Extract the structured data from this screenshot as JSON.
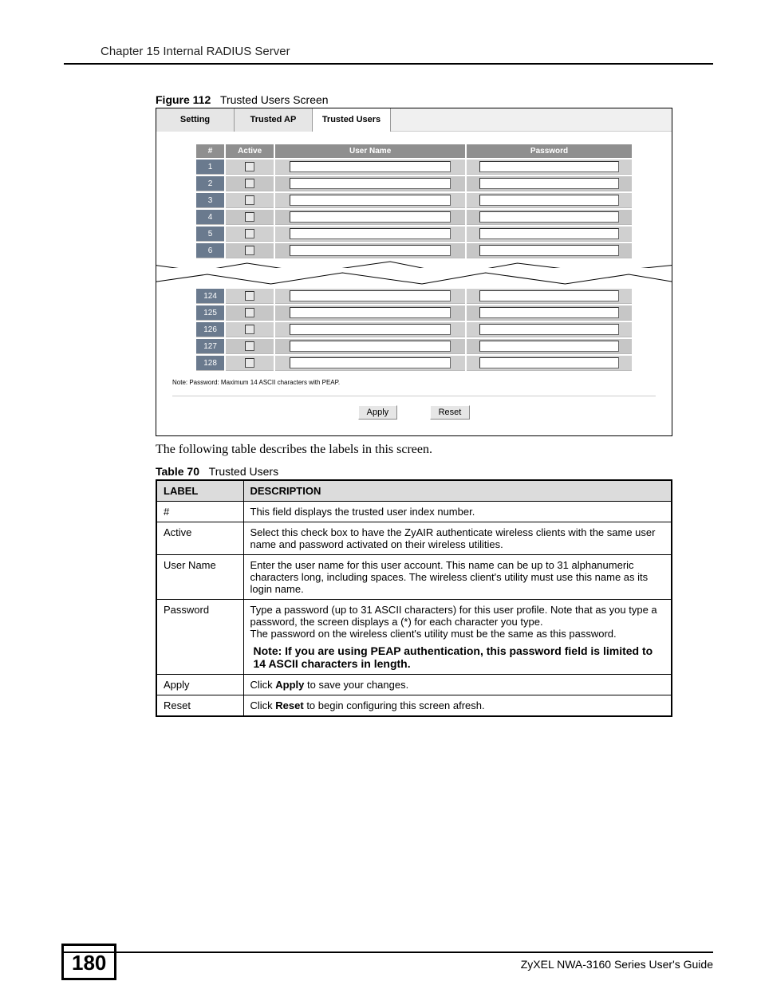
{
  "chapter": "Chapter 15 Internal RADIUS Server",
  "figure": {
    "label": "Figure 112",
    "title": "Trusted Users Screen"
  },
  "tabs": {
    "setting": "Setting",
    "trusted_ap": "Trusted AP",
    "trusted_users": "Trusted Users"
  },
  "cols": {
    "num": "#",
    "active": "Active",
    "user_name": "User Name",
    "password": "Password"
  },
  "rows_top": [
    "1",
    "2",
    "3",
    "4",
    "5",
    "6"
  ],
  "rows_bottom": [
    "124",
    "125",
    "126",
    "127",
    "128"
  ],
  "note": "Note: Password: Maximum 14 ASCII characters with PEAP.",
  "buttons": {
    "apply": "Apply",
    "reset": "Reset"
  },
  "intro": "The following table describes the labels in this screen.",
  "table_caption": {
    "label": "Table 70",
    "title": "Trusted Users"
  },
  "desc": {
    "header_label": "LABEL",
    "header_desc": "DESCRIPTION",
    "rows": {
      "num": {
        "label": "#",
        "text": "This field displays the trusted user index number."
      },
      "active": {
        "label": "Active",
        "text": "Select this check box to have the ZyAIR authenticate wireless clients with the same user name and password activated on their wireless utilities."
      },
      "uname": {
        "label": "User Name",
        "text": "Enter the user name for this user account. This name can be up to 31 alphanumeric characters long, including spaces. The wireless client's utility must use this name as its login name."
      },
      "pwd": {
        "label": "Password",
        "p1": "Type a password (up to 31 ASCII characters) for this user profile. Note that as you type a password, the screen displays a (*) for each character you type.",
        "p2": "The password on the wireless client's utility must be the same as this password.",
        "note": "Note: If you are using PEAP authentication, this password field is limited to 14 ASCII characters in length."
      },
      "apply": {
        "label": "Apply",
        "pre": "Click ",
        "b": "Apply",
        "post": " to save your changes."
      },
      "reset": {
        "label": "Reset",
        "pre": "Click ",
        "b": "Reset",
        "post": " to begin configuring this screen afresh."
      }
    }
  },
  "footer": {
    "page": "180",
    "guide": "ZyXEL NWA-3160 Series User's Guide"
  }
}
